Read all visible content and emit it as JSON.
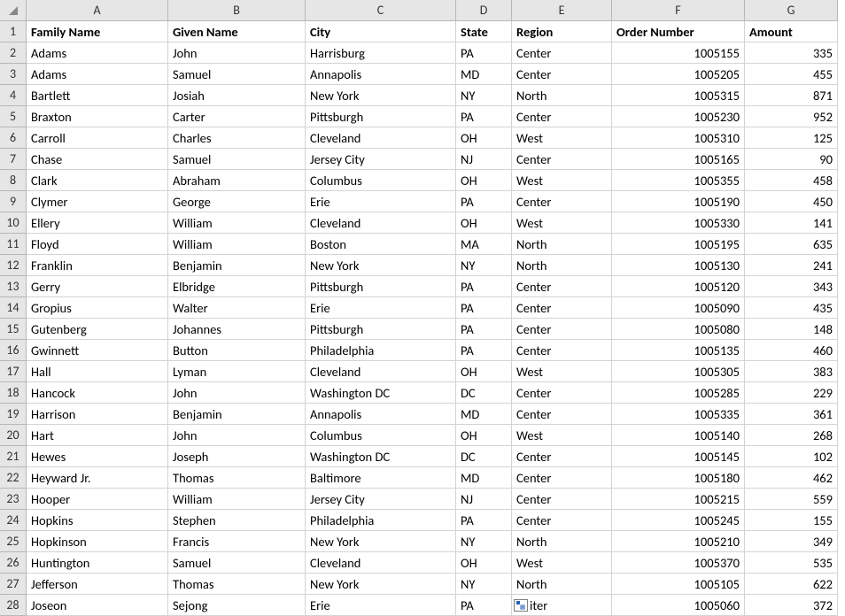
{
  "columns": [
    "A",
    "B",
    "C",
    "D",
    "E",
    "F",
    "G"
  ],
  "headers": {
    "family_name": "Family Name",
    "given_name": "Given Name",
    "city": "City",
    "state": "State",
    "region": "Region",
    "order_number": "Order Number",
    "amount": "Amount"
  },
  "rows": [
    {
      "rn": "1"
    },
    {
      "rn": "2",
      "family": "Adams",
      "given": "John",
      "city": "Harrisburg",
      "state": "PA",
      "region": "Center",
      "order": "1005155",
      "amount": "335"
    },
    {
      "rn": "3",
      "family": "Adams",
      "given": "Samuel",
      "city": "Annapolis",
      "state": "MD",
      "region": "Center",
      "order": "1005205",
      "amount": "455"
    },
    {
      "rn": "4",
      "family": "Bartlett",
      "given": "Josiah",
      "city": "New York",
      "state": "NY",
      "region": "North",
      "order": "1005315",
      "amount": "871"
    },
    {
      "rn": "5",
      "family": "Braxton",
      "given": "Carter",
      "city": "Pittsburgh",
      "state": "PA",
      "region": "Center",
      "order": "1005230",
      "amount": "952"
    },
    {
      "rn": "6",
      "family": "Carroll",
      "given": "Charles",
      "city": "Cleveland",
      "state": "OH",
      "region": "West",
      "order": "1005310",
      "amount": "125"
    },
    {
      "rn": "7",
      "family": "Chase",
      "given": "Samuel",
      "city": "Jersey City",
      "state": "NJ",
      "region": "Center",
      "order": "1005165",
      "amount": "90"
    },
    {
      "rn": "8",
      "family": "Clark",
      "given": "Abraham",
      "city": "Columbus",
      "state": "OH",
      "region": "West",
      "order": "1005355",
      "amount": "458"
    },
    {
      "rn": "9",
      "family": "Clymer",
      "given": "George",
      "city": "Erie",
      "state": "PA",
      "region": "Center",
      "order": "1005190",
      "amount": "450"
    },
    {
      "rn": "10",
      "family": "Ellery",
      "given": "William",
      "city": "Cleveland",
      "state": "OH",
      "region": "West",
      "order": "1005330",
      "amount": "141"
    },
    {
      "rn": "11",
      "family": "Floyd",
      "given": "William",
      "city": "Boston",
      "state": "MA",
      "region": "North",
      "order": "1005195",
      "amount": "635"
    },
    {
      "rn": "12",
      "family": "Franklin",
      "given": "Benjamin",
      "city": "New York",
      "state": "NY",
      "region": "North",
      "order": "1005130",
      "amount": "241"
    },
    {
      "rn": "13",
      "family": "Gerry",
      "given": "Elbridge",
      "city": "Pittsburgh",
      "state": "PA",
      "region": "Center",
      "order": "1005120",
      "amount": "343"
    },
    {
      "rn": "14",
      "family": "Gropius",
      "given": "Walter",
      "city": "Erie",
      "state": "PA",
      "region": "Center",
      "order": "1005090",
      "amount": "435"
    },
    {
      "rn": "15",
      "family": "Gutenberg",
      "given": "Johannes",
      "city": "Pittsburgh",
      "state": "PA",
      "region": "Center",
      "order": "1005080",
      "amount": "148"
    },
    {
      "rn": "16",
      "family": "Gwinnett",
      "given": "Button",
      "city": "Philadelphia",
      "state": "PA",
      "region": "Center",
      "order": "1005135",
      "amount": "460"
    },
    {
      "rn": "17",
      "family": "Hall",
      "given": "Lyman",
      "city": "Cleveland",
      "state": "OH",
      "region": "West",
      "order": "1005305",
      "amount": "383"
    },
    {
      "rn": "18",
      "family": "Hancock",
      "given": "John",
      "city": "Washington DC",
      "state": "DC",
      "region": "Center",
      "order": "1005285",
      "amount": "229"
    },
    {
      "rn": "19",
      "family": "Harrison",
      "given": "Benjamin",
      "city": "Annapolis",
      "state": "MD",
      "region": "Center",
      "order": "1005335",
      "amount": "361"
    },
    {
      "rn": "20",
      "family": "Hart",
      "given": "John",
      "city": "Columbus",
      "state": "OH",
      "region": "West",
      "order": "1005140",
      "amount": "268"
    },
    {
      "rn": "21",
      "family": "Hewes",
      "given": "Joseph",
      "city": "Washington DC",
      "state": "DC",
      "region": "Center",
      "order": "1005145",
      "amount": "102"
    },
    {
      "rn": "22",
      "family": "Heyward Jr.",
      "given": "Thomas",
      "city": "Baltimore",
      "state": "MD",
      "region": "Center",
      "order": "1005180",
      "amount": "462"
    },
    {
      "rn": "23",
      "family": "Hooper",
      "given": "William",
      "city": "Jersey City",
      "state": "NJ",
      "region": "Center",
      "order": "1005215",
      "amount": "559"
    },
    {
      "rn": "24",
      "family": "Hopkins",
      "given": "Stephen",
      "city": "Philadelphia",
      "state": "PA",
      "region": "Center",
      "order": "1005245",
      "amount": "155"
    },
    {
      "rn": "25",
      "family": "Hopkinson",
      "given": "Francis",
      "city": "New York",
      "state": "NY",
      "region": "North",
      "order": "1005210",
      "amount": "349"
    },
    {
      "rn": "26",
      "family": "Huntington",
      "given": "Samuel",
      "city": "Cleveland",
      "state": "OH",
      "region": "West",
      "order": "1005370",
      "amount": "535"
    },
    {
      "rn": "27",
      "family": "Jefferson",
      "given": "Thomas",
      "city": "New York",
      "state": "NY",
      "region": "North",
      "order": "1005105",
      "amount": "622"
    },
    {
      "rn": "28",
      "family": "Joseon",
      "given": "Sejong",
      "city": "Erie",
      "state": "PA",
      "region_suffix": "iter",
      "order": "1005060",
      "amount": "372"
    }
  ],
  "chart_data": {
    "type": "table",
    "columns": [
      "Family Name",
      "Given Name",
      "City",
      "State",
      "Region",
      "Order Number",
      "Amount"
    ],
    "rows": [
      [
        "Adams",
        "John",
        "Harrisburg",
        "PA",
        "Center",
        1005155,
        335
      ],
      [
        "Adams",
        "Samuel",
        "Annapolis",
        "MD",
        "Center",
        1005205,
        455
      ],
      [
        "Bartlett",
        "Josiah",
        "New York",
        "NY",
        "North",
        1005315,
        871
      ],
      [
        "Braxton",
        "Carter",
        "Pittsburgh",
        "PA",
        "Center",
        1005230,
        952
      ],
      [
        "Carroll",
        "Charles",
        "Cleveland",
        "OH",
        "West",
        1005310,
        125
      ],
      [
        "Chase",
        "Samuel",
        "Jersey City",
        "NJ",
        "Center",
        1005165,
        90
      ],
      [
        "Clark",
        "Abraham",
        "Columbus",
        "OH",
        "West",
        1005355,
        458
      ],
      [
        "Clymer",
        "George",
        "Erie",
        "PA",
        "Center",
        1005190,
        450
      ],
      [
        "Ellery",
        "William",
        "Cleveland",
        "OH",
        "West",
        1005330,
        141
      ],
      [
        "Floyd",
        "William",
        "Boston",
        "MA",
        "North",
        1005195,
        635
      ],
      [
        "Franklin",
        "Benjamin",
        "New York",
        "NY",
        "North",
        1005130,
        241
      ],
      [
        "Gerry",
        "Elbridge",
        "Pittsburgh",
        "PA",
        "Center",
        1005120,
        343
      ],
      [
        "Gropius",
        "Walter",
        "Erie",
        "PA",
        "Center",
        1005090,
        435
      ],
      [
        "Gutenberg",
        "Johannes",
        "Pittsburgh",
        "PA",
        "Center",
        1005080,
        148
      ],
      [
        "Gwinnett",
        "Button",
        "Philadelphia",
        "PA",
        "Center",
        1005135,
        460
      ],
      [
        "Hall",
        "Lyman",
        "Cleveland",
        "OH",
        "West",
        1005305,
        383
      ],
      [
        "Hancock",
        "John",
        "Washington DC",
        "DC",
        "Center",
        1005285,
        229
      ],
      [
        "Harrison",
        "Benjamin",
        "Annapolis",
        "MD",
        "Center",
        1005335,
        361
      ],
      [
        "Hart",
        "John",
        "Columbus",
        "OH",
        "West",
        1005140,
        268
      ],
      [
        "Hewes",
        "Joseph",
        "Washington DC",
        "DC",
        "Center",
        1005145,
        102
      ],
      [
        "Heyward Jr.",
        "Thomas",
        "Baltimore",
        "MD",
        "Center",
        1005180,
        462
      ],
      [
        "Hooper",
        "William",
        "Jersey City",
        "NJ",
        "Center",
        1005215,
        559
      ],
      [
        "Hopkins",
        "Stephen",
        "Philadelphia",
        "PA",
        "Center",
        1005245,
        155
      ],
      [
        "Hopkinson",
        "Francis",
        "New York",
        "NY",
        "North",
        1005210,
        349
      ],
      [
        "Huntington",
        "Samuel",
        "Cleveland",
        "OH",
        "West",
        1005370,
        535
      ],
      [
        "Jefferson",
        "Thomas",
        "New York",
        "NY",
        "North",
        1005105,
        622
      ],
      [
        "Joseon",
        "Sejong",
        "Erie",
        "PA",
        null,
        1005060,
        372
      ]
    ]
  }
}
